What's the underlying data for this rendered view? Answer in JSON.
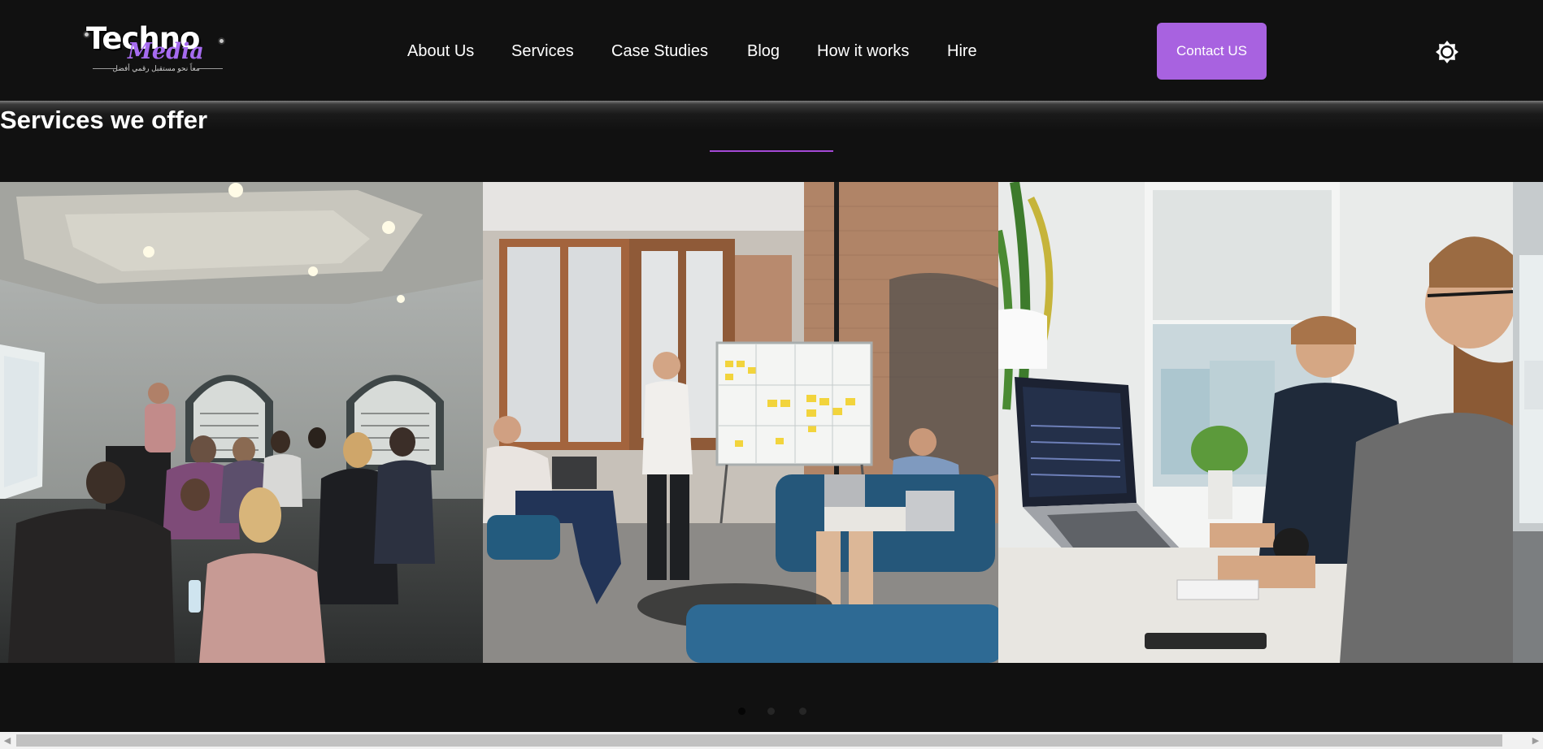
{
  "header": {
    "logo": {
      "main": "Techno",
      "sub": "Media",
      "tagline": "معاً نحو مستقبل رقمي أفضل"
    },
    "nav": [
      {
        "label": "About Us"
      },
      {
        "label": "Services"
      },
      {
        "label": "Case Studies"
      },
      {
        "label": "Blog"
      },
      {
        "label": "How it works"
      },
      {
        "label": "Hire"
      }
    ],
    "contact_label": "Contact US",
    "theme_toggle_icon": "sun-icon",
    "accent_color": "#a862e0"
  },
  "services": {
    "title": "Services we offer",
    "underline_color": "#a449d6",
    "slides": [
      {
        "image": "conference-presentation-photo"
      },
      {
        "image": "team-whiteboard-meeting-photo"
      },
      {
        "image": "developers-at-laptop-photo"
      },
      {
        "image": "partial-next-slide-photo"
      }
    ],
    "dots": [
      {
        "active": true
      },
      {
        "active": false
      },
      {
        "active": false
      }
    ]
  }
}
